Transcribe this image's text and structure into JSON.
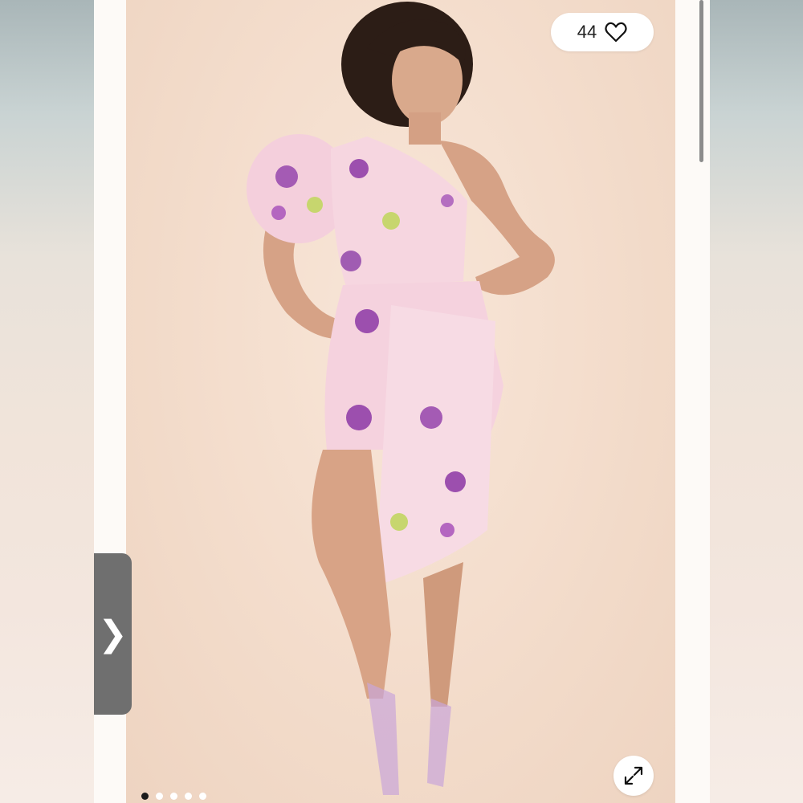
{
  "product_photo": {
    "alt_subject": "model-in-floral-one-shoulder-dress",
    "likes": {
      "count": "44",
      "icon": "heart-icon"
    },
    "controls": {
      "next_icon": "chevron-right-icon",
      "next_glyph": "❯",
      "expand_icon": "expand-arrows-icon"
    },
    "carousel": {
      "total": 5,
      "active_index": 0
    }
  },
  "colors": {
    "background": "#f3dccb",
    "dress_base": "#f6d4de",
    "floral_purple": "#9c4fae",
    "floral_green": "#c7d66e",
    "nav_tab": "#6f6f6f",
    "active_dot": "#1b1b1b"
  }
}
